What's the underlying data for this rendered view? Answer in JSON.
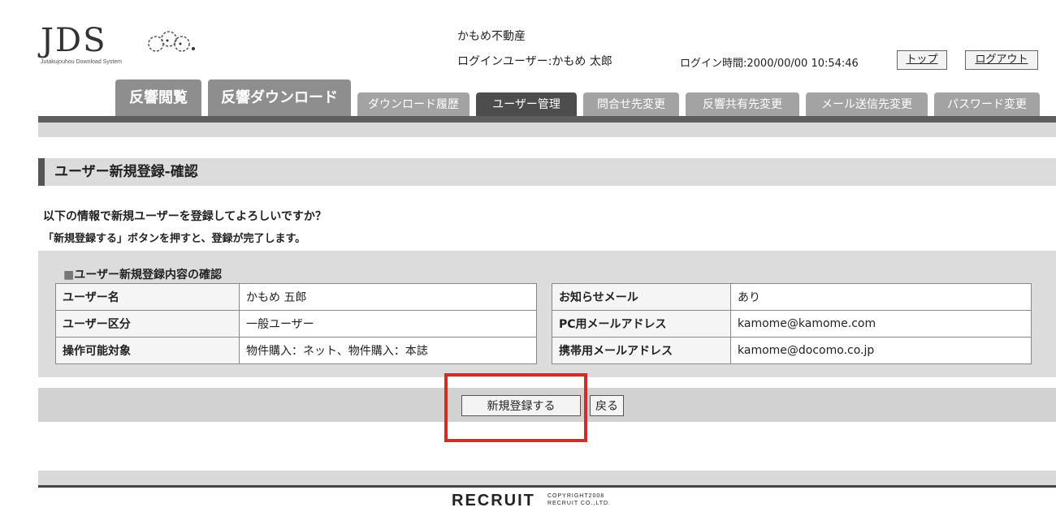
{
  "logo": {
    "brand": "JDS",
    "subtitle": "Jutakujouhou Download System"
  },
  "header": {
    "company": "かもめ不動産",
    "login_user": "ログインユーザー:かもめ 太郎",
    "login_time": "ログイン時間:2000/00/00 10:54:46",
    "top_label": "トップ",
    "logout_label": "ログアウト"
  },
  "tabs": [
    {
      "label": "反響閲覧"
    },
    {
      "label": "反響ダウンロード"
    },
    {
      "label": "ダウンロード履歴"
    },
    {
      "label": "ユーザー管理"
    },
    {
      "label": "問合せ先変更"
    },
    {
      "label": "反響共有先変更"
    },
    {
      "label": "メール送信先変更"
    },
    {
      "label": "パスワード変更"
    }
  ],
  "section_title": "ユーザー新規登録-確認",
  "messages": {
    "line1": "以下の情報で新規ユーザーを登録してよろしいですか？",
    "line2": "「新規登録する」ボタンを押すと、登録が完了します。"
  },
  "confirm": {
    "title": "ユーザー新規登録内容の確認",
    "left_rows": [
      {
        "label": "ユーザー名",
        "value": "かもめ 五郎"
      },
      {
        "label": "ユーザー区分",
        "value": "一般ユーザー"
      },
      {
        "label": "操作可能対象",
        "value": "物件購入：ネット、物件購入：本誌"
      }
    ],
    "right_rows": [
      {
        "label": "お知らせメール",
        "value": "あり"
      },
      {
        "label": "PC用メールアドレス",
        "value": "kamome@kamome.com"
      },
      {
        "label": "携帯用メールアドレス",
        "value": "kamome@docomo.co.jp"
      }
    ]
  },
  "actions": {
    "register_label": "新規登録する",
    "back_label": "戻る"
  },
  "footer": {
    "brand": "RECRUIT",
    "copyright_line1": "COPYRIGHT2008",
    "copyright_line2": "RECRUIT CO.,LTD."
  },
  "colors": {
    "highlight": "#d32a2a",
    "tab_active": "#4d4d4d",
    "tab": "#a3a3a3"
  }
}
